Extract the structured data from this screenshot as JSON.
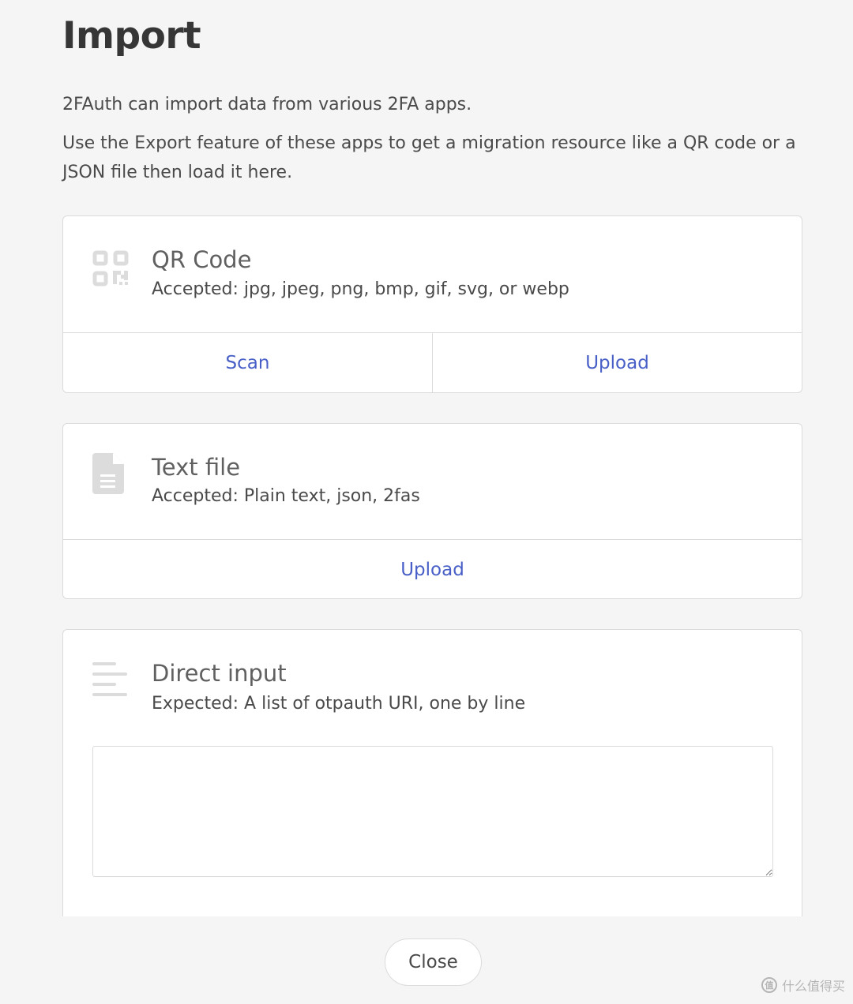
{
  "page": {
    "title": "Import",
    "intro": [
      "2FAuth can import data from various 2FA apps.",
      "Use the Export feature of these apps to get a migration resource like a QR code or a JSON file then load it here."
    ]
  },
  "qr_card": {
    "icon": "qrcode-icon",
    "title": "QR Code",
    "subtitle": "Accepted: jpg, jpeg, png, bmp, gif, svg, or webp",
    "scan_label": "Scan",
    "upload_label": "Upload"
  },
  "text_file_card": {
    "icon": "file-text-icon",
    "title": "Text file",
    "subtitle": "Accepted: Plain text, json, 2fas",
    "upload_label": "Upload"
  },
  "direct_input_card": {
    "icon": "align-left-icon",
    "title": "Direct input",
    "subtitle": "Expected: A list of otpauth URI, one by line",
    "value": ""
  },
  "footer": {
    "close_label": "Close"
  },
  "watermark": {
    "logo_text": "值",
    "text": "什么值得买"
  },
  "colors": {
    "link": "#485fc7",
    "border": "#dbdbdb",
    "background": "#f5f5f5"
  }
}
